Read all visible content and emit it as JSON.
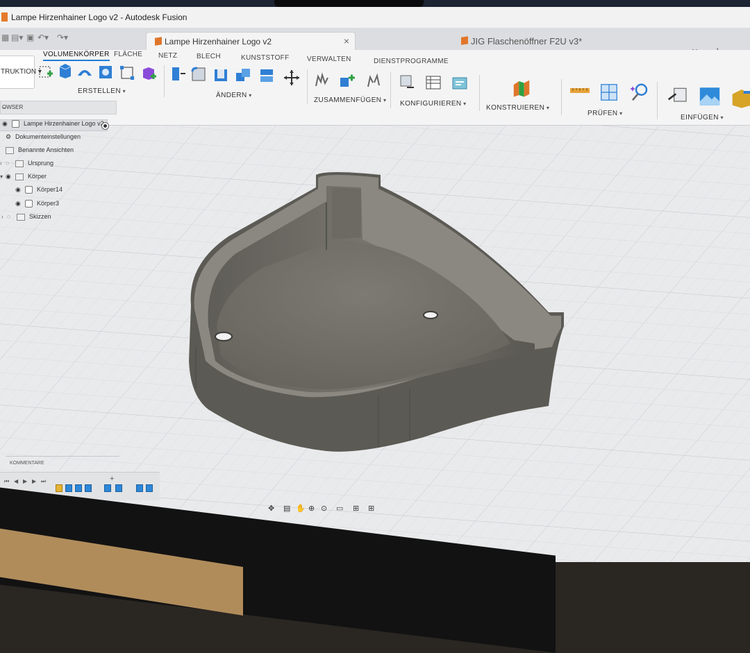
{
  "window": {
    "title": "Lampe Hirzenhainer Logo v2 - Autodesk Fusion"
  },
  "tabs": {
    "active": {
      "label": "Lampe Hirzenhainer Logo v2",
      "close": "×"
    },
    "other": {
      "label": "JIG Flaschenöffner F2U v3*",
      "close": "×"
    },
    "add": "+"
  },
  "ribbon": {
    "workspace": "TRUKTION ▾",
    "tabs": [
      "VOLUMENKÖRPER",
      "FLÄCHE",
      "NETZ",
      "BLECH",
      "KUNSTSTOFF",
      "VERWALTEN",
      "DIENSTPROGRAMME"
    ],
    "groups": [
      "ERSTELLEN",
      "ÄNDERN",
      "ZUSAMMENFÜGEN",
      "KONFIGURIEREN",
      "KONSTRUIEREN",
      "PRÜFEN",
      "EINFÜGEN"
    ]
  },
  "browser": {
    "header": "OWSER",
    "collapse": "–",
    "root": "Lampe Hirzenhainer Logo v2",
    "items": [
      {
        "label": "Dokumenteinstellungen"
      },
      {
        "label": "Benannte Ansichten"
      },
      {
        "label": "Ursprung"
      },
      {
        "label": "Körper"
      },
      {
        "label": "Körper14"
      },
      {
        "label": "Körper3"
      },
      {
        "label": "Skizzen"
      }
    ]
  },
  "comments": {
    "label": "KOMMENTARE",
    "add": "+"
  },
  "colors": {
    "accent": "#1c7fd6",
    "model": "#6f6d66",
    "canvas": "#e9eaec"
  },
  "icons": {
    "nav": [
      "orbit-icon",
      "look-at-icon",
      "pan-icon",
      "zoom-icon",
      "fit-icon",
      "display-settings-icon",
      "grid-icon",
      "viewports-icon"
    ]
  }
}
